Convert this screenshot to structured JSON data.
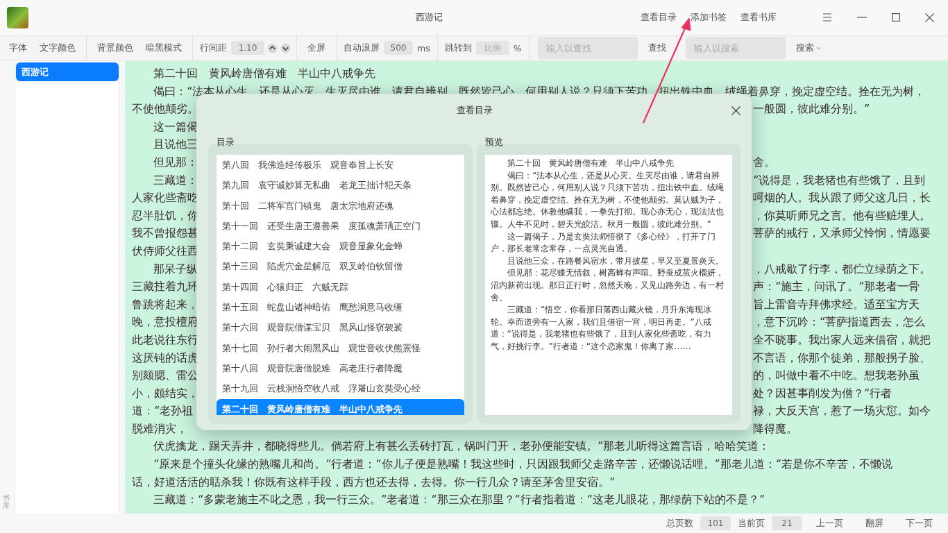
{
  "window": {
    "title": "西游记",
    "actions": [
      "查看目录",
      "添加书签",
      "查看书库"
    ]
  },
  "toolbar": [
    {
      "kind": "button",
      "label": "字体"
    },
    {
      "kind": "button",
      "label": "文字颜色"
    },
    {
      "kind": "separator"
    },
    {
      "kind": "button",
      "label": "背景颜色"
    },
    {
      "kind": "button",
      "label": "暗黑模式"
    },
    {
      "kind": "separator"
    },
    {
      "kind": "label",
      "label": "行间距"
    },
    {
      "kind": "field",
      "value": "1.10"
    },
    {
      "kind": "stepper"
    },
    {
      "kind": "separator"
    },
    {
      "kind": "button",
      "label": "全屏"
    },
    {
      "kind": "separator"
    },
    {
      "kind": "label",
      "label": "自动滚屏"
    },
    {
      "kind": "field",
      "value": "500"
    },
    {
      "kind": "label",
      "label": "ms"
    },
    {
      "kind": "separator"
    },
    {
      "kind": "label",
      "label": "跳转到"
    },
    {
      "kind": "field",
      "placeholder": "比例"
    },
    {
      "kind": "label",
      "label": "%"
    },
    {
      "kind": "separator"
    },
    {
      "kind": "wide-field",
      "placeholder": "输入以查找"
    },
    {
      "kind": "button",
      "label": "查找"
    },
    {
      "kind": "separator"
    },
    {
      "kind": "wide-field",
      "placeholder": "输入以搜索"
    },
    {
      "kind": "dropdown",
      "label": "搜索"
    }
  ],
  "sidebar": {
    "items": [
      {
        "label": "西游记",
        "selected": true
      }
    ],
    "tab": "书库"
  },
  "reader": {
    "lines": [
      {
        "indent": true,
        "text": "第二十回　黄风岭唐僧有难　半山中八戒争先"
      },
      {
        "indent": true,
        "text": "偈曰：“法本从心生，还是从心灭。生灭尽由谁，请君自辨别。既然皆己心，何用别人说？只须下苦功，扭出铁中血。绒绳着鼻穿，挽定虚空结。拴在无为树，"
      },
      {
        "indent": false,
        "left": "不使他颠劣。",
        "right": "一般圆，彼此难分别。”"
      },
      {
        "indent": true,
        "left": "这一篇偈"
      },
      {
        "indent": true,
        "left": "且说他三"
      },
      {
        "indent": true,
        "left": "但见那：",
        "right": "舍。"
      },
      {
        "indent": true,
        "left": "三藏道：",
        "right": "“说得是，我老猪也有些饿了，且到"
      },
      {
        "indent": false,
        "left": "人家化些斋吃",
        "right": "呵烟的人。我从跟了师父这几日，长"
      },
      {
        "indent": false,
        "left": "忍半肚饥，你",
        "right": "，你莫听师兄之言。他有些赃埋人。"
      },
      {
        "indent": false,
        "left": "我不曾报怨甚",
        "right": "菩萨的戒行，又承师父怜悯，情愿要"
      },
      {
        "indent": false,
        "left": "伏侍师父往西"
      },
      {
        "indent": true,
        "left": "那呆子纵",
        "right": "，八戒歇了行李，都伫立绿荫之下。"
      },
      {
        "indent": false,
        "left": "三藏拄着九环",
        "right": "声：“施主，问讯了。”那老者一骨"
      },
      {
        "indent": false,
        "left": "鲁跳将起来，",
        "right": "旨上雷音寺拜佛求经。适至宝方天"
      },
      {
        "indent": false,
        "left": "晚，意投檀府",
        "right": "，意下沉吟：“菩萨指道西去，怎么"
      },
      {
        "indent": false,
        "left": "此老说往东行",
        "right": "全不晓事。我出家人远来借宿，就把"
      },
      {
        "indent": false,
        "left": "这厌钝的话虎",
        "right": "不言语，你那个徒弟，那般拐子脸、"
      },
      {
        "indent": false,
        "left": "别颏腮、雷公",
        "right": "的，叫做中看不中吃。想我老孙虽"
      },
      {
        "indent": false,
        "left": "小，颇结实，",
        "right": "处？因甚事削发为僧？”行者"
      },
      {
        "indent": false,
        "left": "道：“老孙祖",
        "right": "禄，大反天宫，惹了一场灾愆。如今"
      },
      {
        "indent": false,
        "left": "脱难消灾，",
        "right": "降得魔。"
      },
      {
        "indent": true,
        "text": "伏虎擒龙，踢天弄井，都晓得些儿。倘若府上有甚么丢砖打瓦，锅叫门开，老孙便能安镇。”那老儿听得这篇言语，哈哈笑道："
      },
      {
        "indent": true,
        "text": "“原来是个撞头化缘的熟嘴儿和尚。”行者道：“你儿子便是熟嘴！我这些时，只因跟我师父走路辛苦，还懒说话哩。”那老儿道：“若是你不辛苦，不懒说"
      },
      {
        "indent": false,
        "text": "话，好道活活的聒杀我！你既有这样手段，西方也还去得，去得。你一行几众？请至茅舍里安宿。”"
      },
      {
        "indent": true,
        "text": "三藏道：“多蒙老施主不叱之恩，我一行三众。”老者道：“那三众在那里？”行者指着道：“这老儿眼花，那绿荫下站的不是？”"
      }
    ]
  },
  "dialog": {
    "title": "查看目录",
    "toc_label": "目录",
    "preview_label": "预览",
    "toc": [
      {
        "label": "第八回　我佛造经传极乐　观音奉旨上长安",
        "selected": false
      },
      {
        "label": "第九回　袁守诚妙算无私曲　老龙王拙计犯天条",
        "selected": false
      },
      {
        "label": "第十回　二将军宫门镇鬼　唐太宗地府还魂",
        "selected": false
      },
      {
        "label": "第十一回　还受生唐王遵善果　度孤魂萧瑀正空门",
        "selected": false
      },
      {
        "label": "第十二回　玄奘秉诚建大会　观音显象化金蝉",
        "selected": false
      },
      {
        "label": "第十三回　陷虎穴金星解厄　双叉岭伯钦留僧",
        "selected": false
      },
      {
        "label": "第十四回　心猿归正　六贼无踪",
        "selected": false
      },
      {
        "label": "第十五回　蛇盘山诸神暗佑　鹰愁涧意马收缰",
        "selected": false
      },
      {
        "label": "第十六回　观音院僧谋宝贝　黑风山怪窃袈裟",
        "selected": false
      },
      {
        "label": "第十七回　孙行者大闹黑风山　观世音收伏熊罴怪",
        "selected": false
      },
      {
        "label": "第十八回　观音院唐僧脱难　高老庄行者降魔",
        "selected": false
      },
      {
        "label": "第十九回　云栈洞悟空收八戒　浮屠山玄奘受心经",
        "selected": false
      },
      {
        "label": "第二十回　黄风岭唐僧有难　半山中八戒争先",
        "selected": true
      }
    ],
    "preview": [
      "第二十回　黄风岭唐僧有难　半山中八戒争先",
      "偈曰：“法本从心生，还是从心灭。生灭尽由谁，请君自辨别。既然皆己心，何用别人说？只须下苦功，扭出铁中血。绒绳着鼻穿，挽定虚空结。拴在无为树，不使他颠劣。莫认贼为子，心法都忘绝。休教他瞒我，一拳先打彻。现心亦无心，现法法也辍。人牛不见时，碧天光皎洁。秋月一般圆，彼此难分别。”",
      "这一篇偈子，乃是玄奘法师悟彻了《多心经》，打开了门户，那长老常念常存，一点灵光自透。",
      "且说他三众，在路餐风宿水，带月披星，早又至夏景炎天。",
      "但见那：花尽蝶无情叙，树高蝉有声喧。野蚕成茧火榴妍，沼内新荷出现。那日正行时，忽然天晚，又见山路旁边，有一村舍。",
      "三藏道：“悟空，你看那日落西山藏火镜，月升东海现冰轮。幸而道旁有一人家，我们且借宿一宵，明日再走。”八戒道：“说得是，我老猪也有些饿了，且到人家化些斋吃，有力气，好挑行李。”行者道：“这个恋家鬼！你离了家……"
    ]
  },
  "status_bar": [
    {
      "kind": "label",
      "label": "总页数"
    },
    {
      "kind": "field",
      "value": "101"
    },
    {
      "kind": "label",
      "label": "当前页"
    },
    {
      "kind": "field",
      "value": "21"
    },
    {
      "kind": "button",
      "label": "上一页"
    },
    {
      "kind": "button",
      "label": "翻屏"
    },
    {
      "kind": "button",
      "label": "下一页"
    }
  ]
}
